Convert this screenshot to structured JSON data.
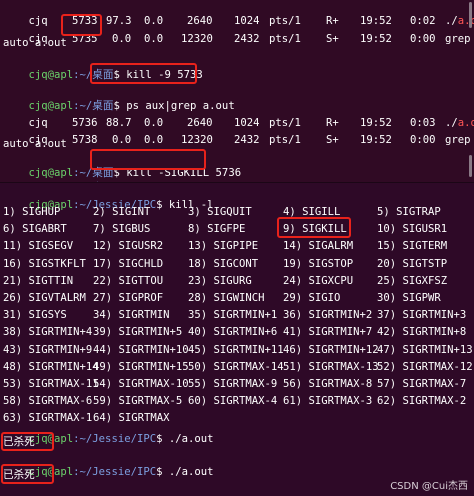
{
  "top_terminal": {
    "row1": {
      "user": "cjq",
      "pid": "5733",
      "cpu": "97.3",
      "mem": "0.0",
      "vsz": "2640",
      "rss": "1024",
      "tty": "pts/1",
      "stat": "R+",
      "start": "19:52",
      "time": "0:02",
      "cmd_prefix": "./",
      "cmd_name": "a.out"
    },
    "row2": {
      "user": "cjq",
      "pid": "5735",
      "cpu": "0.0",
      "mem": "0.0",
      "vsz": "12320",
      "rss": "2432",
      "tty": "pts/1",
      "stat": "S+",
      "start": "19:52",
      "time": "0:00",
      "cmd": "grep --color="
    },
    "wrap1": "auto a.out",
    "prompt_user": "cjq@apl",
    "prompt_path": ":~/桌面",
    "prompt_sym": "$ ",
    "cmd_ps": "ps aux|grep a.out",
    "cmd_kill9": "kill -9 5733",
    "row3": {
      "user": "cjq",
      "pid": "5736",
      "cpu": "88.7",
      "mem": "0.0",
      "vsz": "2640",
      "rss": "1024",
      "tty": "pts/1",
      "stat": "R+",
      "start": "19:52",
      "time": "0:03",
      "cmd_prefix": "./",
      "cmd_name": "a.out"
    },
    "row4": {
      "user": "cjq",
      "pid": "5738",
      "cpu": "0.0",
      "mem": "0.0",
      "vsz": "12320",
      "rss": "2432",
      "tty": "pts/1",
      "stat": "S+",
      "start": "19:52",
      "time": "0:00",
      "cmd": "grep --color="
    },
    "wrap2": "auto a.out",
    "cmd_kill_sig": "kill -SIGKILL 5736"
  },
  "bottom_terminal": {
    "prompt_user": "cjq@apl",
    "prompt_path": ":~/Jessie/IPC",
    "prompt_sym": "$ ",
    "cmd_list": "kill -l",
    "signals": [
      [
        "1) SIGHUP",
        "2) SIGINT",
        "3) SIGQUIT",
        "4) SIGILL",
        "5) SIGTRAP"
      ],
      [
        "6) SIGABRT",
        "7) SIGBUS",
        "8) SIGFPE",
        "9) SIGKILL",
        "10) SIGUSR1"
      ],
      [
        "11) SIGSEGV",
        "12) SIGUSR2",
        "13) SIGPIPE",
        "14) SIGALRM",
        "15) SIGTERM"
      ],
      [
        "16) SIGSTKFLT",
        "17) SIGCHLD",
        "18) SIGCONT",
        "19) SIGSTOP",
        "20) SIGTSTP"
      ],
      [
        "21) SIGTTIN",
        "22) SIGTTOU",
        "23) SIGURG",
        "24) SIGXCPU",
        "25) SIGXFSZ"
      ],
      [
        "26) SIGVTALRM",
        "27) SIGPROF",
        "28) SIGWINCH",
        "29) SIGIO",
        "30) SIGPWR"
      ],
      [
        "31) SIGSYS",
        "34) SIGRTMIN",
        "35) SIGRTMIN+1",
        "36) SIGRTMIN+2",
        "37) SIGRTMIN+3"
      ],
      [
        "38) SIGRTMIN+4",
        "39) SIGRTMIN+5",
        "40) SIGRTMIN+6",
        "41) SIGRTMIN+7",
        "42) SIGRTMIN+8"
      ],
      [
        "43) SIGRTMIN+9",
        "44) SIGRTMIN+10",
        "45) SIGRTMIN+11",
        "46) SIGRTMIN+12",
        "47) SIGRTMIN+13"
      ],
      [
        "48) SIGRTMIN+14",
        "49) SIGRTMIN+15",
        "50) SIGRTMAX-14",
        "51) SIGRTMAX-13",
        "52) SIGRTMAX-12"
      ],
      [
        "53) SIGRTMAX-11",
        "54) SIGRTMAX-10",
        "55) SIGRTMAX-9",
        "56) SIGRTMAX-8",
        "57) SIGRTMAX-7"
      ],
      [
        "58) SIGRTMAX-6",
        "59) SIGRTMAX-5",
        "60) SIGRTMAX-4",
        "61) SIGRTMAX-3",
        "62) SIGRTMAX-2"
      ],
      [
        "63) SIGRTMAX-1",
        "64) SIGRTMAX"
      ]
    ],
    "cmd_run": "./a.out",
    "killed": "已杀死"
  },
  "watermark": "CSDN @Cui杰西",
  "colors": {
    "background": "#300a24",
    "prompt_user": "#6bd36b",
    "prompt_path": "#7c9fe0",
    "exec_name": "#ff5555",
    "highlight_box": "#e8221b"
  }
}
